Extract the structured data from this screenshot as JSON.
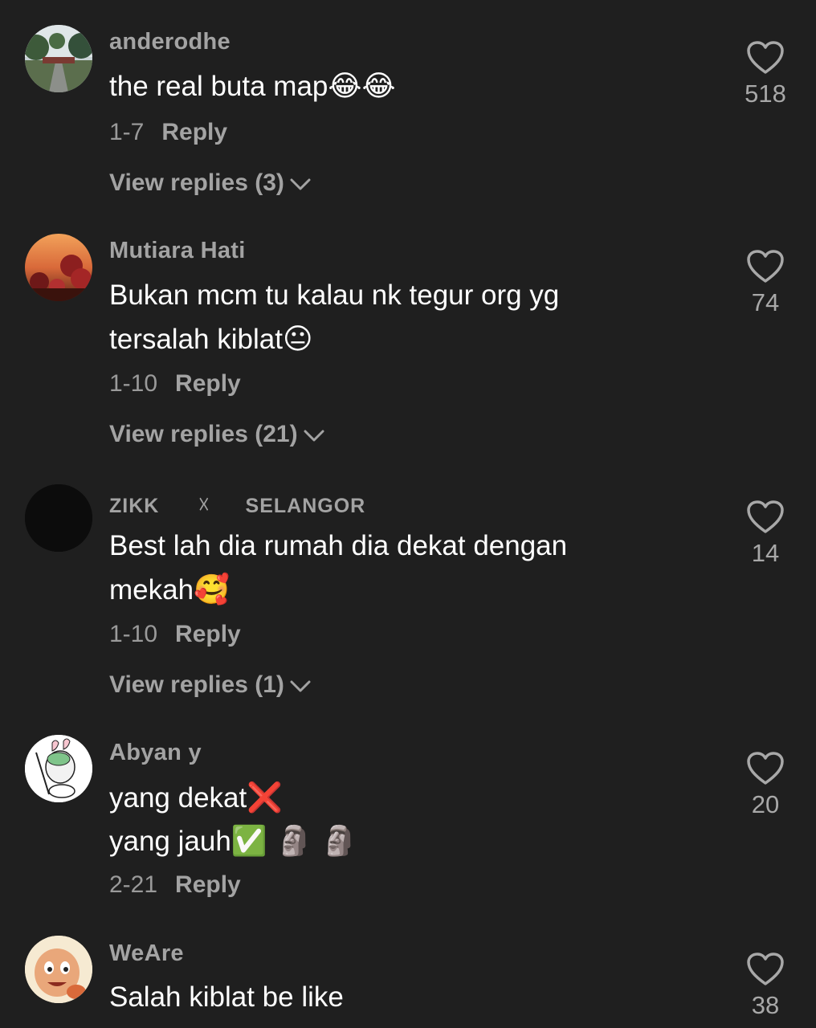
{
  "comments": [
    {
      "username": "anderodhe",
      "lines": [
        "the real buta map"
      ],
      "line_emojis": [
        "😂😂"
      ],
      "date": "1-7",
      "reply_label": "Reply",
      "view_replies": "View replies (3)",
      "likes": "518",
      "avatar_icon": "photo-road-avatar"
    },
    {
      "username": "Mutiara Hati",
      "lines": [
        "Bukan mcm tu kalau nk tegur org yg",
        "tersalah kiblat"
      ],
      "line_emojis": [
        "",
        "😐"
      ],
      "date": "1-10",
      "reply_label": "Reply",
      "view_replies": "View replies (21)",
      "likes": "74",
      "avatar_icon": "sunset-flowers-avatar"
    },
    {
      "username_parts": [
        "ZIKK",
        "☓",
        "SELANGOR"
      ],
      "lines": [
        "Best lah dia rumah dia dekat dengan",
        "mekah"
      ],
      "line_emojis": [
        "",
        "🥰"
      ],
      "date": "1-10",
      "reply_label": "Reply",
      "view_replies": "View replies (1)",
      "likes": "14",
      "avatar_icon": "black-avatar"
    },
    {
      "username": "Abyan y",
      "lines": [
        "yang dekat",
        "yang jauh"
      ],
      "line_emojis": [
        "❌",
        "✅ 🗿 🗿"
      ],
      "date": "2-21",
      "reply_label": "Reply",
      "likes": "20",
      "avatar_icon": "cartoon-character-avatar"
    },
    {
      "username": "WeAre",
      "lines": [
        "Salah kiblat be like"
      ],
      "line_emojis": [
        ""
      ],
      "likes": "38",
      "avatar_icon": "cartoon-boy-avatar"
    }
  ],
  "colors": {
    "background": "#1f1f1f",
    "text": "#ffffff",
    "muted": "#a3a3a3"
  }
}
